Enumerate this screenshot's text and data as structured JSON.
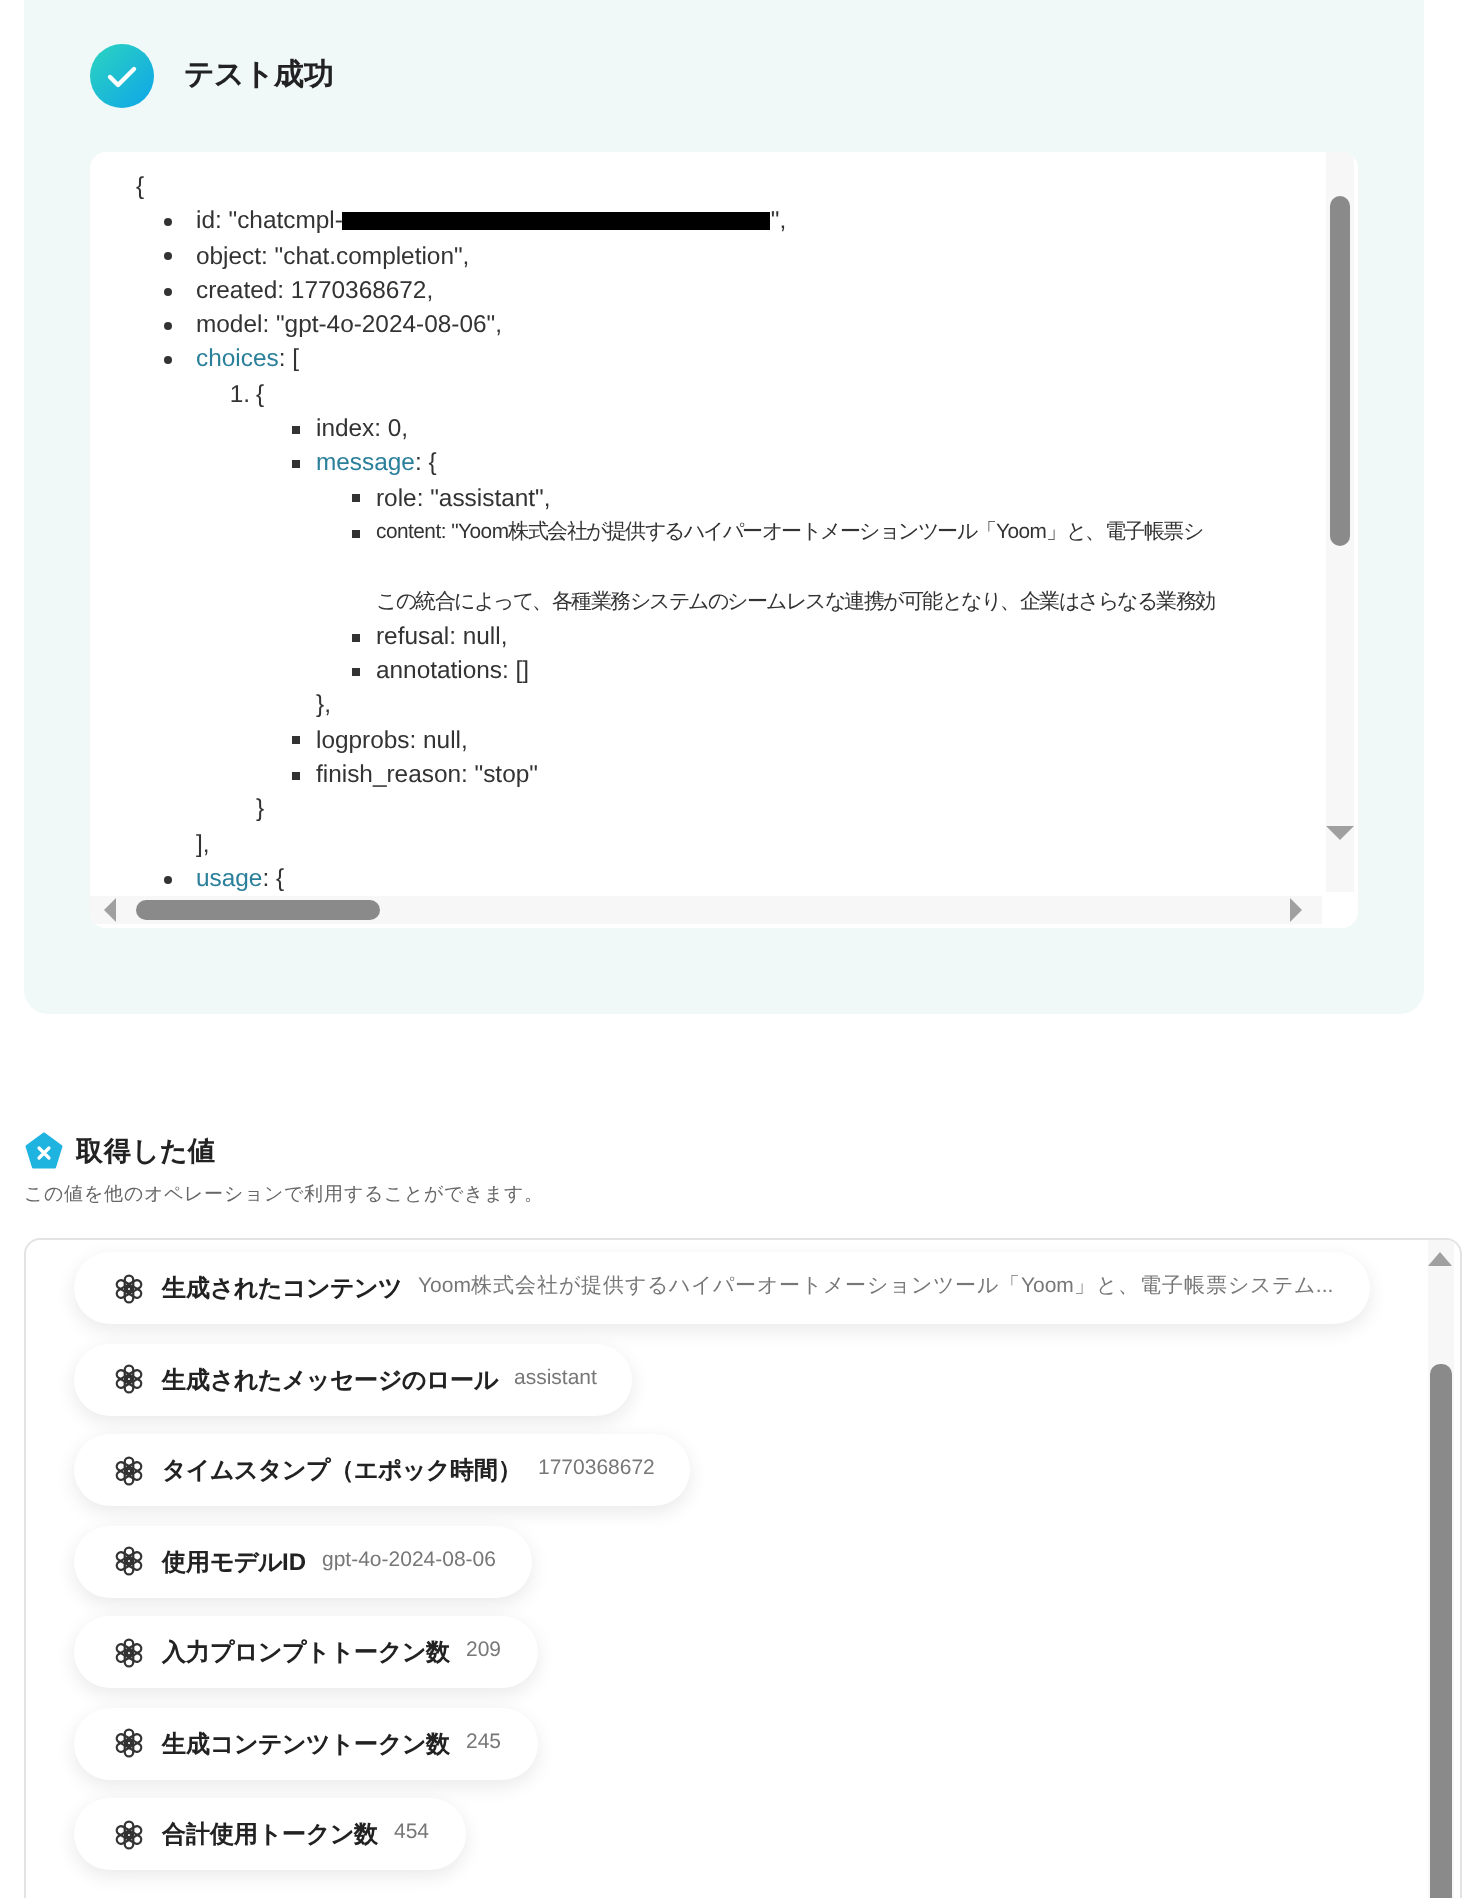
{
  "result": {
    "title": "テスト成功",
    "response": {
      "open": "{",
      "items": [
        {
          "text": "id: \"chatcmpl-",
          "redacted": true,
          "text_after": "\","
        },
        {
          "text": "object: \"chat.completion\","
        },
        {
          "text": "created: 1770368672,"
        },
        {
          "text": "model: \"gpt-4o-2024-08-06\","
        },
        {
          "key": "choices",
          "text": ": [",
          "close": "],",
          "children": [
            {
              "number": "1.",
              "text": "{",
              "close": "}",
              "children": [
                {
                  "text": "index: 0,"
                },
                {
                  "key": "message",
                  "text": ": {",
                  "close": "},",
                  "children": [
                    {
                      "text": "role: \"assistant\","
                    },
                    {
                      "text": "content: \"Yoom株式会社が提供するハイパーオートメーションツール「Yoom」と、電子帳票シ",
                      "continuation": "この統合によって、各種業務システムのシームレスな連携が可能となり、企業はさらなる業務効"
                    },
                    {
                      "text": "refusal: null,"
                    },
                    {
                      "text": "annotations: []"
                    }
                  ]
                },
                {
                  "text": "logprobs: null,"
                },
                {
                  "text": "finish_reason: \"stop\""
                }
              ]
            }
          ]
        },
        {
          "key": "usage",
          "text": ": {"
        }
      ]
    }
  },
  "values": {
    "title": "取得した値",
    "description": "この値を他のオペレーションで利用することができます。",
    "items": [
      {
        "label": "生成されたコンテンツ",
        "value": "Yoom株式会社が提供するハイパーオートメーションツール「Yoom」と、電子帳票システム..."
      },
      {
        "label": "生成されたメッセージのロール",
        "value": "assistant"
      },
      {
        "label": "タイムスタンプ（エポック時間）",
        "value": "1770368672"
      },
      {
        "label": "使用モデルID",
        "value": "gpt-4o-2024-08-06"
      },
      {
        "label": "入力プロンプトトークン数",
        "value": "209"
      },
      {
        "label": "生成コンテンツトークン数",
        "value": "245"
      },
      {
        "label": "合計使用トークン数",
        "value": "454"
      }
    ]
  }
}
